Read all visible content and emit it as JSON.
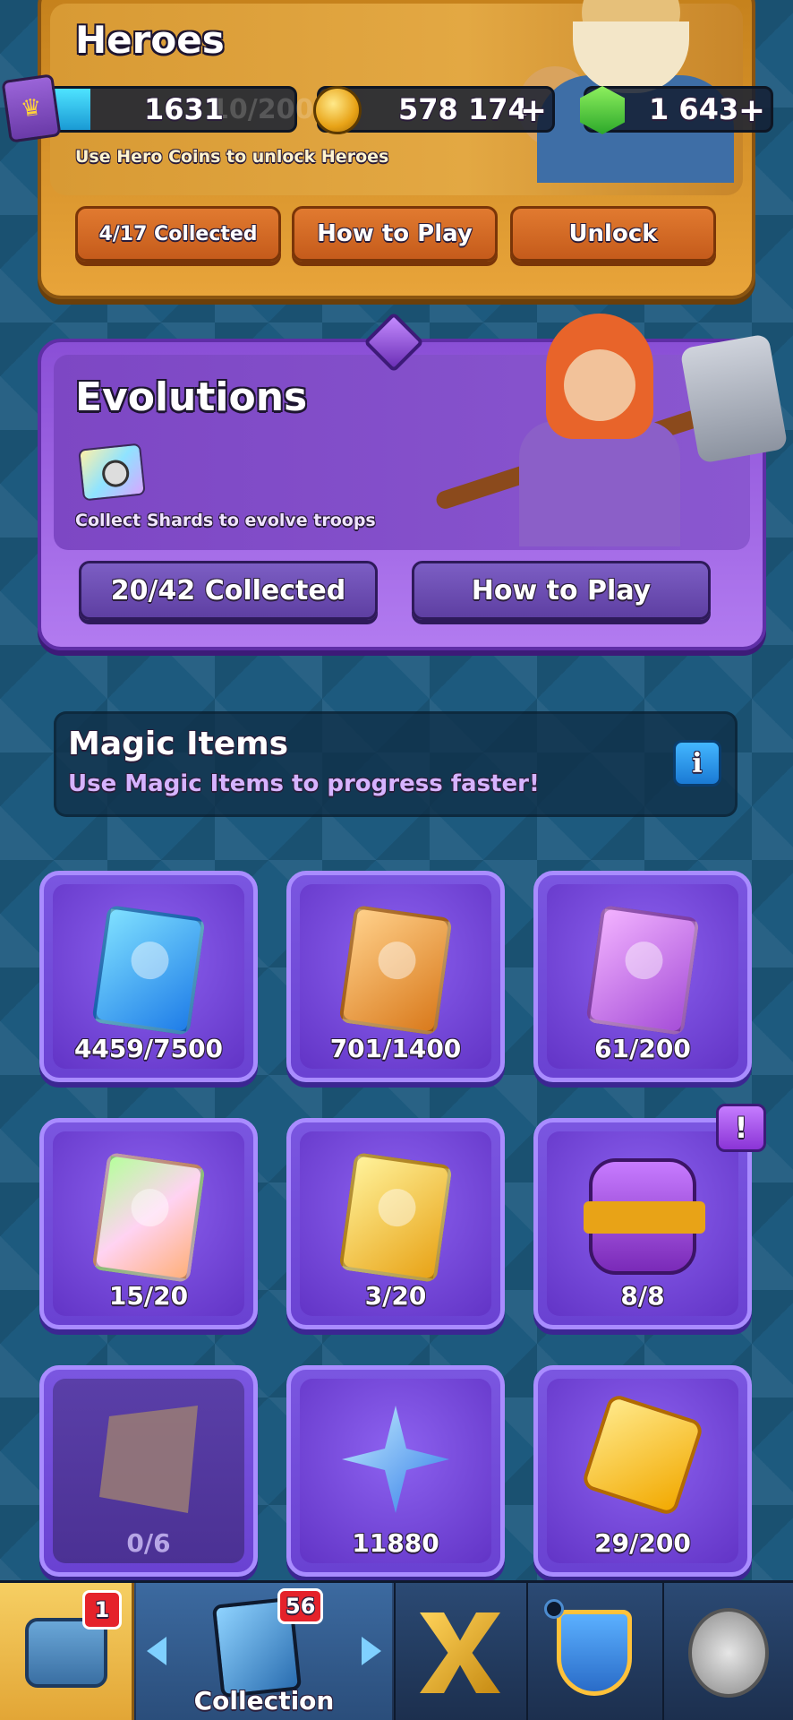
{
  "heroes": {
    "title": "Heroes",
    "hint": "Use Hero Coins to unlock Heroes",
    "collected_label": "4/17 Collected",
    "how_to_play_label": "How to Play",
    "unlock_label": "Unlock"
  },
  "resources": {
    "cards_value": "1631",
    "cards_ghost": "10/200",
    "gold_value": "578 174",
    "gems_value": "1 643",
    "plus": "+",
    "accent_gold": "#e8a317",
    "accent_gem": "#2ca82a"
  },
  "evolutions": {
    "title": "Evolutions",
    "hint": "Collect Shards to evolve troops",
    "collected_label": "20/42 Collected",
    "how_to_play_label": "How to Play"
  },
  "magic_items": {
    "title": "Magic Items",
    "subtitle": "Use Magic Items to progress faster!",
    "info_icon": "i",
    "items": [
      {
        "icon": "common-book-icon",
        "label": "4459/7500"
      },
      {
        "icon": "rare-book-icon",
        "label": "701/1400"
      },
      {
        "icon": "epic-book-icon",
        "label": "61/200"
      },
      {
        "icon": "legendary-book-icon",
        "label": "15/20"
      },
      {
        "icon": "champion-book-icon",
        "label": "3/20"
      },
      {
        "icon": "elixir-potion-icon",
        "label": "8/8"
      },
      {
        "icon": "shard-icon",
        "label": "0/6"
      },
      {
        "icon": "star-point-icon",
        "label": "11880"
      },
      {
        "icon": "gold-token-icon",
        "label": "29/200"
      }
    ],
    "alert_mark": "!"
  },
  "nav": {
    "shop_badge": "1",
    "cards_badge": "56",
    "cards_label": "Collection"
  }
}
